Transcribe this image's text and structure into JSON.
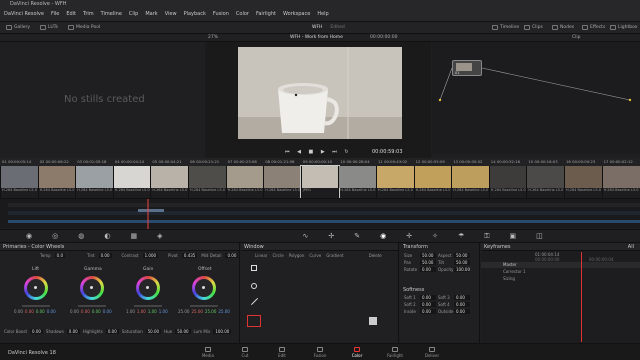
{
  "app": {
    "title": "DaVinci Resolve - WFH"
  },
  "menu": [
    "DaVinci Resolve",
    "File",
    "Edit",
    "Trim",
    "Timeline",
    "Clip",
    "Mark",
    "View",
    "Playback",
    "Fusion",
    "Color",
    "Fairlight",
    "Workspace",
    "Help"
  ],
  "topbar": {
    "gallery": "Gallery",
    "luts": "LUTs",
    "media_pool": "Media Pool",
    "project": "WFH",
    "edited": "Edited",
    "timeline": "Timeline",
    "clips": "Clips",
    "nodes": "Nodes",
    "effects": "Effects",
    "lightbox": "Lightbox"
  },
  "viewer_header": {
    "zoom": "27%",
    "timeline_name": "WFH - Work from Home",
    "timecode_top": "00:00:00:00",
    "clip_label": "Clip"
  },
  "gallery": {
    "empty_text": "No stills created"
  },
  "viewer": {
    "timecode": "00:00:59:03"
  },
  "node": {
    "label": "01"
  },
  "clips": [
    {
      "num": "01",
      "tc": "00:00:05:14",
      "codec": "H.264 Baseline L5.0",
      "color": "#6a6d74"
    },
    {
      "num": "02",
      "tc": "00:00:06:22",
      "codec": "H.264 Baseline L5.0",
      "color": "#8c7a6a"
    },
    {
      "num": "03",
      "tc": "00:01:05:18",
      "codec": "H.264 Baseline L5.0",
      "color": "#9ba0a4"
    },
    {
      "num": "04",
      "tc": "00:00:04:24",
      "codec": "H.264 Baseline L5.0",
      "color": "#d8d6d2"
    },
    {
      "num": "05",
      "tc": "00:00:04:21",
      "codec": "H.264 Baseline L5.0",
      "color": "#b8b2a8"
    },
    {
      "num": "06",
      "tc": "00:00:21:21",
      "codec": "H.264 Baseline L5.0",
      "color": "#4e4d4a"
    },
    {
      "num": "07",
      "tc": "00:00:23:06",
      "codec": "H.264 Baseline L5.0",
      "color": "#a59b8c"
    },
    {
      "num": "08",
      "tc": "00:01:21:06",
      "codec": "H.264 Baseline L5.0",
      "color": "#8b8176"
    },
    {
      "num": "09",
      "tc": "00:00:00:10",
      "codec": "JPEG",
      "color": "#c3bdb4"
    },
    {
      "num": "10",
      "tc": "00:00:28:04",
      "codec": "H.264 Baseline L5.0",
      "color": "#8a8a88"
    },
    {
      "num": "11",
      "tc": "00:00:43:02",
      "codec": "H.264 Baseline L5.0",
      "color": "#c8a868"
    },
    {
      "num": "12",
      "tc": "00:00:55:09",
      "codec": "H.264 Baseline L5.0",
      "color": "#c0a05a"
    },
    {
      "num": "13",
      "tc": "00:00:05:02",
      "codec": "H.264 Baseline L5.0",
      "color": "#bd9e5c"
    },
    {
      "num": "14",
      "tc": "00:00:52:16",
      "codec": "H.264 Baseline L5.0",
      "color": "#3e3c3a"
    },
    {
      "num": "15",
      "tc": "00:00:16:03",
      "codec": "H.264 Baseline L5.0",
      "color": "#4c4a48"
    },
    {
      "num": "16",
      "tc": "00:00:00:23",
      "codec": "H.264 Baseline L5.0",
      "color": "#6c5c4e"
    },
    {
      "num": "17",
      "tc": "00:00:02:12",
      "codec": "H.264 Baseline L5.0",
      "color": "#7b6e66"
    }
  ],
  "primaries": {
    "title": "Primaries - Color Wheels",
    "temp_label": "Temp",
    "temp": "0.0",
    "tint_label": "Tint",
    "tint": "0.00",
    "contrast_label": "Contrast",
    "contrast": "1.000",
    "pivot_label": "Pivot",
    "pivot": "0.435",
    "middetail_label": "Mid Detail",
    "middetail": "0.00",
    "wheels": [
      {
        "name": "Lift",
        "vals": [
          "0.00",
          "0.00",
          "0.00",
          "0.00"
        ]
      },
      {
        "name": "Gamma",
        "vals": [
          "0.00",
          "0.00",
          "0.00",
          "0.00"
        ]
      },
      {
        "name": "Gain",
        "vals": [
          "1.00",
          "1.00",
          "1.00",
          "1.00"
        ]
      },
      {
        "name": "Offset",
        "vals": [
          "25.00",
          "25.00",
          "25.00",
          "25.00"
        ]
      }
    ],
    "colorboost_label": "Color Boost",
    "colorboost": "0.00",
    "shadows_label": "Shadows",
    "shadows": "0.00",
    "highlights_label": "Highlights",
    "highlights": "0.00",
    "saturation_label": "Saturation",
    "saturation": "50.00",
    "hue_label": "Hue",
    "hue": "50.00",
    "lummix_label": "Lum Mix",
    "lummix": "100.00"
  },
  "window": {
    "title": "Window",
    "tools": [
      "Linear",
      "Circle",
      "Polygon",
      "Curve",
      "Gradient"
    ],
    "delete": "Delete"
  },
  "transform": {
    "title": "Transform",
    "size_label": "Size",
    "size": "50.00",
    "aspect_label": "Aspect",
    "aspect": "50.00",
    "pan_label": "Pan",
    "pan": "50.00",
    "tilt_label": "Tilt",
    "tilt": "50.00",
    "rotate_label": "Rotate",
    "rotate": "0.00",
    "opacity_label": "Opacity",
    "opacity": "100.00",
    "softness_title": "Softness",
    "soft1_label": "Soft 1",
    "soft1": "0.00",
    "soft2_label": "Soft 2",
    "soft2": "0.00",
    "soft3_label": "Soft 3",
    "soft3": "0.00",
    "soft4_label": "Soft 4",
    "soft4": "0.00",
    "inside_label": "Inside",
    "inside": "0.00",
    "outside_label": "Outside",
    "outside": "0.00"
  },
  "keyframes": {
    "title": "Keyframes",
    "filter": "All",
    "tc": "01:00:04:14",
    "tc2": "00:00:00:00",
    "tc3": "00:00:00:04",
    "master": "Master",
    "corrector": "Corrector 1",
    "sizing": "Sizing"
  },
  "pages": [
    {
      "name": "Media",
      "active": false
    },
    {
      "name": "Cut",
      "active": false
    },
    {
      "name": "Edit",
      "active": false
    },
    {
      "name": "Fusion",
      "active": false
    },
    {
      "name": "Color",
      "active": true
    },
    {
      "name": "Fairlight",
      "active": false
    },
    {
      "name": "Deliver",
      "active": false
    }
  ],
  "version": "DaVinci Resolve 18"
}
